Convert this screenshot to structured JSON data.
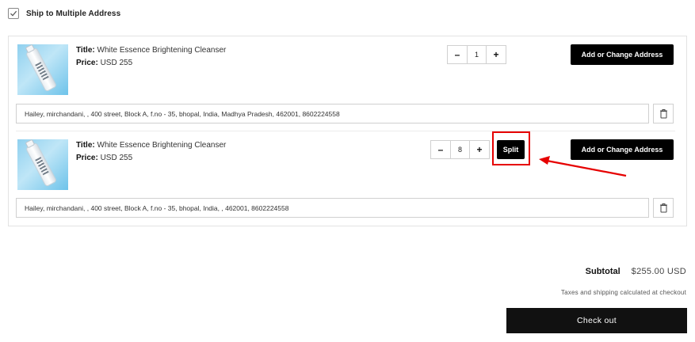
{
  "ship_multiple": {
    "checked": true,
    "label": "Ship to Multiple Address"
  },
  "items": [
    {
      "title_label": "Title:",
      "title": "White Essence Brightening Cleanser",
      "price_label": "Price:",
      "price": "USD 255",
      "qty_minus": "–",
      "quantity": "1",
      "qty_plus": "+",
      "address_button": "Add or Change Address",
      "address": "Hailey, mirchandani, , 400 street, Block A, f.no - 35, bhopal, India, Madhya Pradesh, 462001, 8602224558"
    },
    {
      "title_label": "Title:",
      "title": "White Essence Brightening Cleanser",
      "price_label": "Price:",
      "price": "USD 255",
      "qty_minus": "–",
      "quantity": "8",
      "qty_plus": "+",
      "split_button": "Split",
      "address_button": "Add or Change Address",
      "address": "Hailey, mirchandani, , 400 street, Block A, f.no - 35, bhopal, India, , 462001, 8602224558"
    }
  ],
  "summary": {
    "subtotal_label": "Subtotal",
    "subtotal_value": "$255.00 USD",
    "taxes_note": "Taxes and shipping calculated at checkout",
    "checkout_label": "Check out"
  },
  "annotation": {
    "highlight_color": "#e60000",
    "arrow_color": "#e60000"
  },
  "icons": {
    "checkbox": "checkmark-icon",
    "remove": "trash-icon"
  }
}
